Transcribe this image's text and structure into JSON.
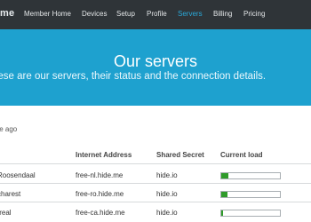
{
  "nav": {
    "logo": "me",
    "items": [
      "Member Home",
      "Devices",
      "Setup",
      "Profile",
      "Servers",
      "Billing",
      "Pricing"
    ],
    "active": "Servers"
  },
  "hero": {
    "title": "Our servers",
    "subtitle": "hese are our servers, their status and the connection details."
  },
  "updated_text": "te ago",
  "table": {
    "headers": [
      "Internet Address",
      "Shared Secret",
      "Current load"
    ],
    "rows": [
      {
        "name": "Roosendaal",
        "address": "free-nl.hide.me",
        "secret": "hide.io",
        "load": 0.12
      },
      {
        "name": "charest",
        "address": "free-ro.hide.me",
        "secret": "hide.io",
        "load": 0.1
      },
      {
        "name": "treal",
        "address": "free-ca.hide.me",
        "secret": "hide.io",
        "load": 0.03
      }
    ]
  },
  "colors": {
    "nav_bg": "#2f3438",
    "hero_bg": "#1ea1cf",
    "active_nav": "#2aa8d8",
    "load_bar": "#2f9b2a"
  }
}
